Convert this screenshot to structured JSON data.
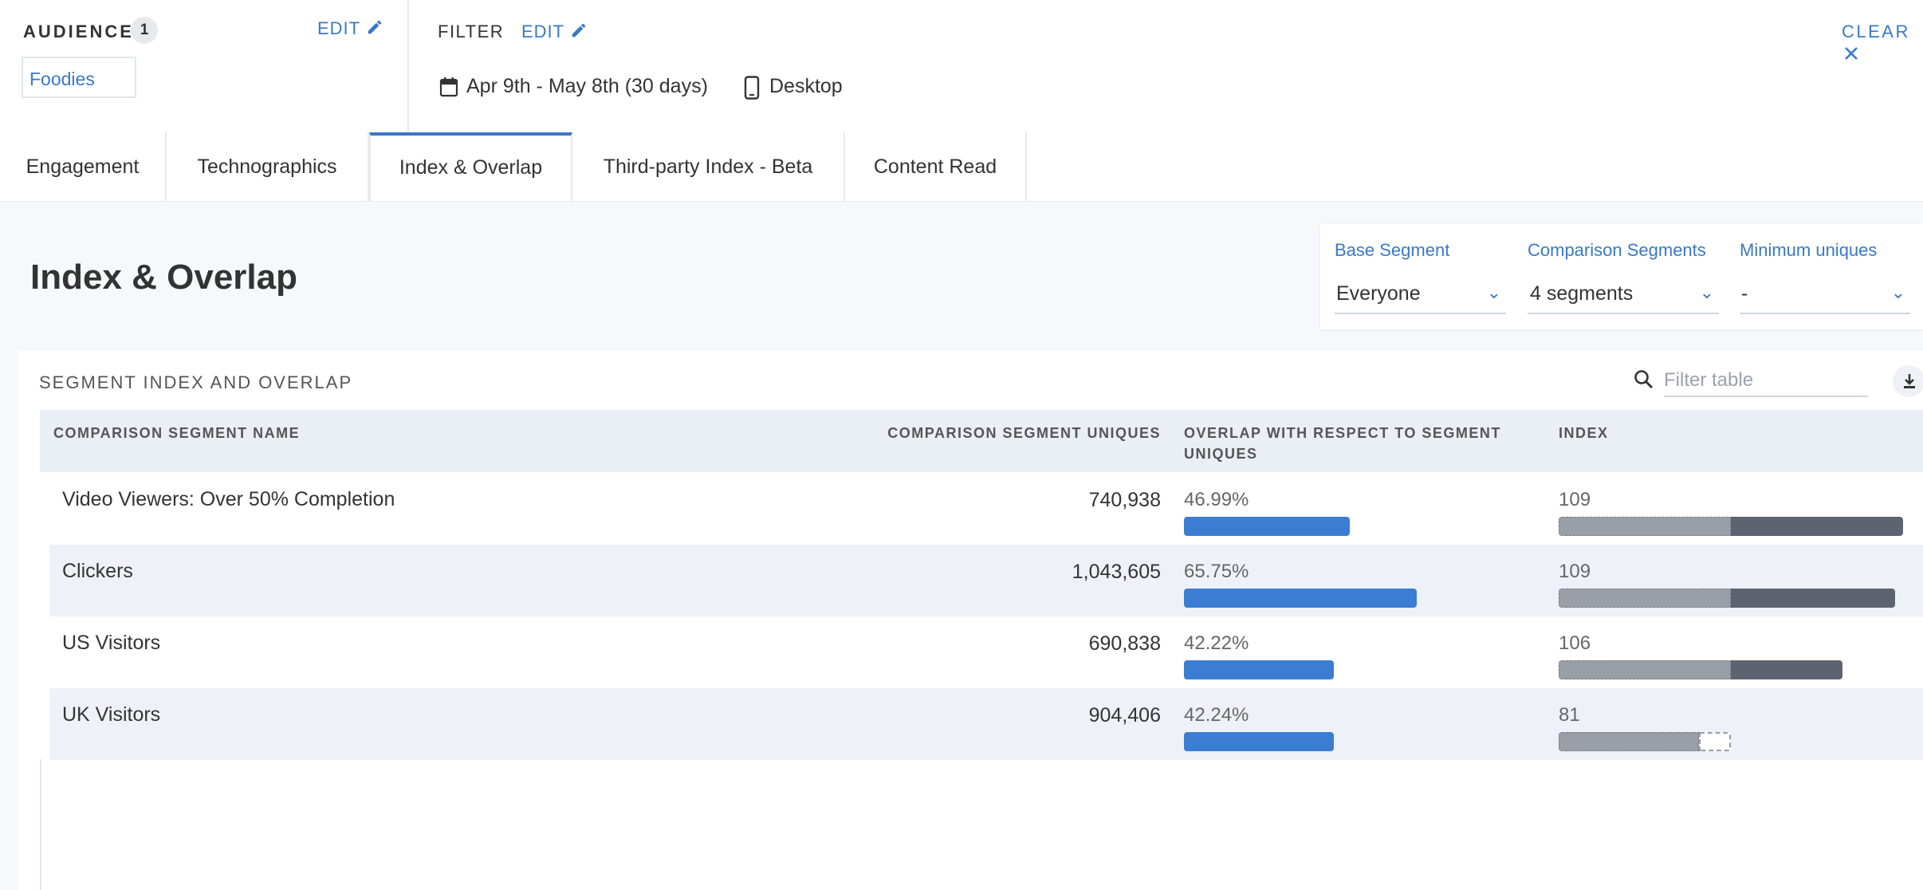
{
  "audience": {
    "title": "AUDIENCE",
    "count": "1",
    "edit_label": "EDIT",
    "chip": "Foodies"
  },
  "filter": {
    "title": "FILTER",
    "edit_label": "EDIT",
    "date_range": "Apr 9th - May 8th (30 days)",
    "device": "Desktop",
    "clear_label": "CLEAR"
  },
  "tabs": [
    {
      "label": "Engagement"
    },
    {
      "label": "Technographics"
    },
    {
      "label": "Index & Overlap",
      "active": true
    },
    {
      "label": "Third-party Index - Beta"
    },
    {
      "label": "Content Read"
    }
  ],
  "page": {
    "title": "Index & Overlap"
  },
  "segments": {
    "base_label": "Base Segment",
    "base_value": "Everyone",
    "comparison_label": "Comparison Segments",
    "comparison_value": "4 segments",
    "min_label": "Minimum uniques",
    "min_value": "-"
  },
  "table": {
    "title": "SEGMENT INDEX AND OVERLAP",
    "filter_placeholder": "Filter table",
    "headers": {
      "name": "COMPARISON SEGMENT NAME",
      "uniques": "COMPARISON SEGMENT UNIQUES",
      "overlap_line1": "OVERLAP WITH RESPECT TO SEGMENT",
      "overlap_line2": "UNIQUES",
      "index": "INDEX"
    },
    "rows": [
      {
        "name": "Video Viewers: Over 50% Completion",
        "uniques": "740,938",
        "overlap": "46.99%",
        "overlap_value": 46.99,
        "index": "109",
        "index_value": 109
      },
      {
        "name": "Clickers",
        "uniques": "1,043,605",
        "overlap": "65.75%",
        "overlap_value": 65.75,
        "index": "109",
        "index_value": 109
      },
      {
        "name": "US Visitors",
        "uniques": "690,838",
        "overlap": "42.22%",
        "overlap_value": 42.22,
        "index": "106",
        "index_value": 106
      },
      {
        "name": "UK Visitors",
        "uniques": "904,406",
        "overlap": "42.24%",
        "overlap_value": 42.24,
        "index": "81",
        "index_value": 81
      }
    ]
  },
  "colors": {
    "accent": "#3a78c9",
    "overlap_bar": "#3a7dd2",
    "index_below": "#9a9ea6",
    "index_above": "#5d636f"
  }
}
